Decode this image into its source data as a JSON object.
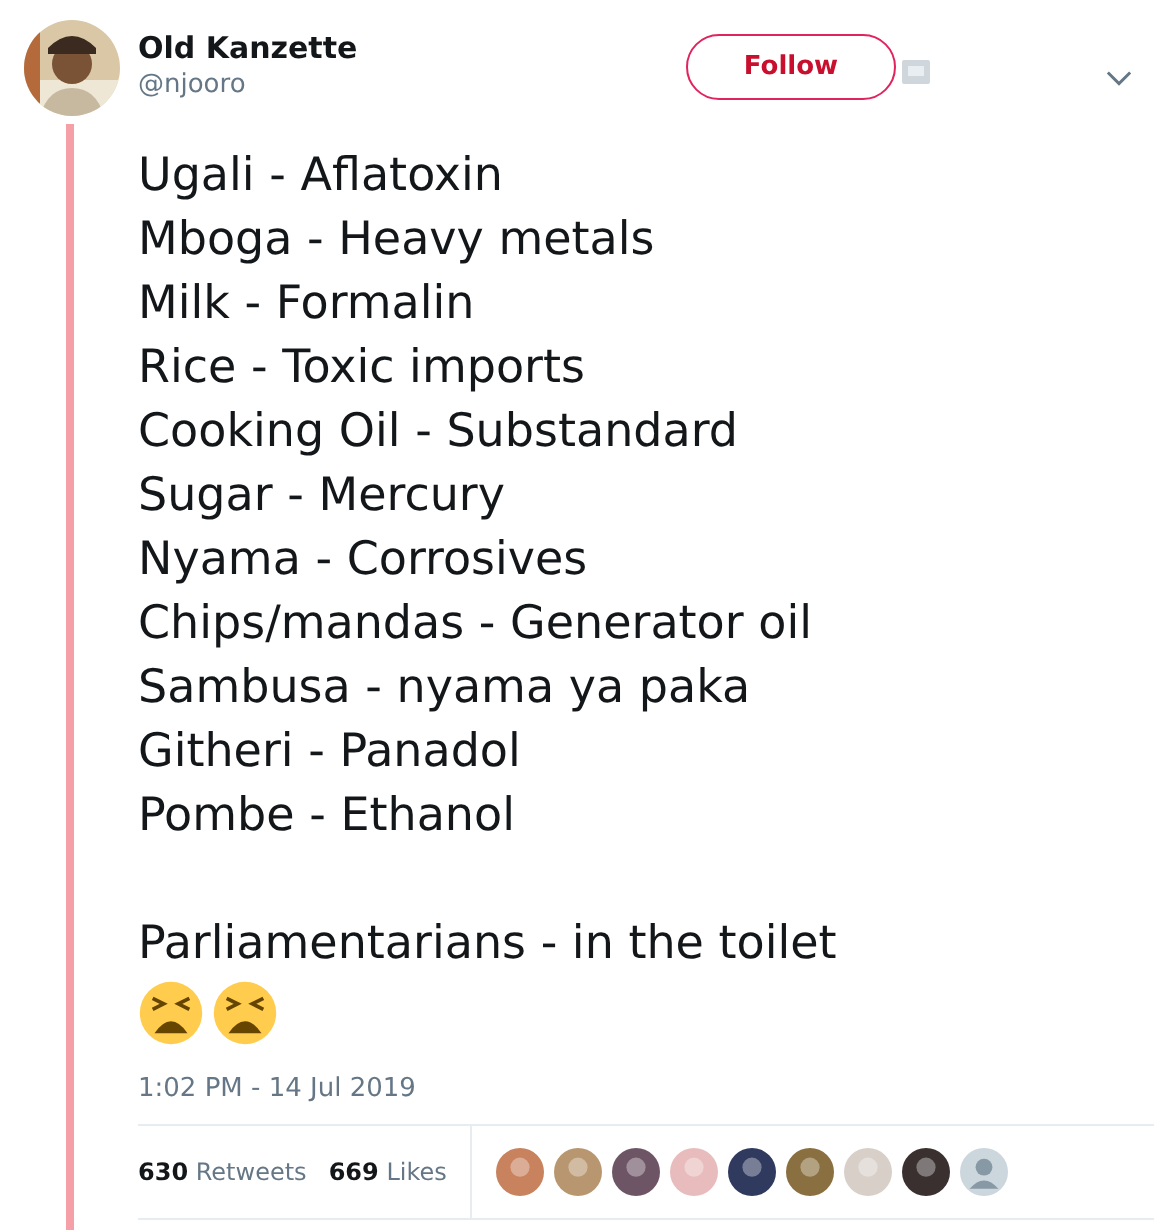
{
  "author": {
    "name": "Old Kanzette",
    "handle": "@njooro"
  },
  "follow_button": "Follow",
  "tweet_lines": [
    "Ugali - Aflatoxin",
    "Mboga - Heavy metals",
    "Milk - Formalin",
    "Rice - Toxic imports",
    "Cooking Oil - Substandard",
    "Sugar - Mercury",
    "Nyama - Corrosives",
    "Chips/mandas - Generator oil",
    "Sambusa - nyama ya paka",
    "Githeri - Panadol",
    "Pombe - Ethanol"
  ],
  "tweet_closing": "Parliamentarians - in the toilet",
  "timestamp": "1:02 PM - 14 Jul 2019",
  "stats": [
    {
      "count": "630",
      "label": "Retweets"
    },
    {
      "count": "669",
      "label": "Likes"
    }
  ]
}
